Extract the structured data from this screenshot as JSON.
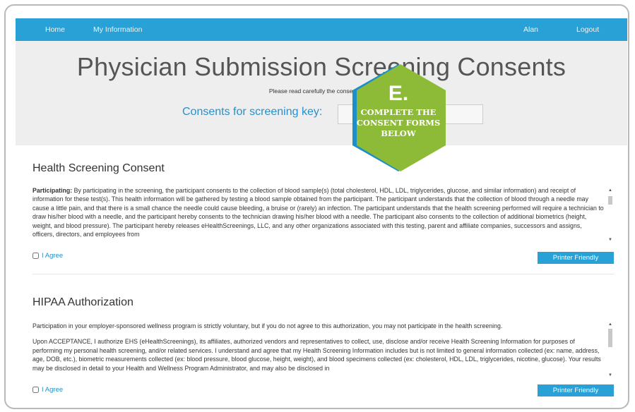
{
  "nav": {
    "home": "Home",
    "my_information": "My Information",
    "user": "Alan",
    "logout": "Logout"
  },
  "hero": {
    "title": "Physician Submission Screening Consents",
    "subtitle": "Please read carefully the consents belo",
    "key_label": "Consents for screening key:"
  },
  "badge": {
    "letter": "E.",
    "line1": "COMPLETE THE",
    "line2": "CONSENT FORMS",
    "line3": "BELOW",
    "color_fill": "#8dbb38",
    "color_edge": "#1c8fc9"
  },
  "health": {
    "title": "Health Screening Consent",
    "bold_lead": "Participating:",
    "text": " By participating in the screening, the participant consents to the collection of blood sample(s) (total cholesterol, HDL, LDL, triglycerides, glucose, and similar information) and receipt of information for these test(s). This health information will be gathered by testing a blood sample obtained from the participant. The participant understands that the collection of blood through a needle may cause a little pain, and that there is a small chance the needle could cause bleeding, a bruise or (rarely) an infection. The participant understands that the health screening performed will require a technician to draw his/her blood with a needle, and the participant hereby consents to the technician drawing his/her blood with a needle. The participant also consents to the collection of additional biometrics (height, weight, and blood pressure). The participant hereby releases eHealthScreenings, LLC, and any other organizations associated with this testing, parent and affiliate companies, successors and assigns, officers, directors, and employees from",
    "agree_label": "I Agree",
    "printer_label": "Printer Friendly"
  },
  "hipaa": {
    "title": "HIPAA Authorization",
    "para1": "Participation in your employer-sponsored wellness program is strictly voluntary, but if you do not agree to this authorization, you may not participate in the health screening.",
    "para2": "Upon ACCEPTANCE, I authorize EHS (eHealthScreenings), its affiliates, authorized vendors and representatives to collect, use, disclose and/or receive Health Screening Information for purposes of performing my personal health screening, and/or related services. I understand and agree that my Health Screening Information includes but is not limited to general information collected (ex: name, address, age, DOB, etc.), biometric measurements collected (ex: blood pressure, blood glucose, height, weight), and blood specimens collected (ex: cholesterol, HDL, LDL, triglycerides, nicotine, glucose). Your results may be disclosed in detail to your Health and Wellness Program Administrator, and may also be disclosed in",
    "agree_label": "I Agree",
    "printer_label": "Printer Friendly"
  },
  "colors": {
    "accent": "#29a0d6",
    "hero_bg": "#eeeeee"
  }
}
